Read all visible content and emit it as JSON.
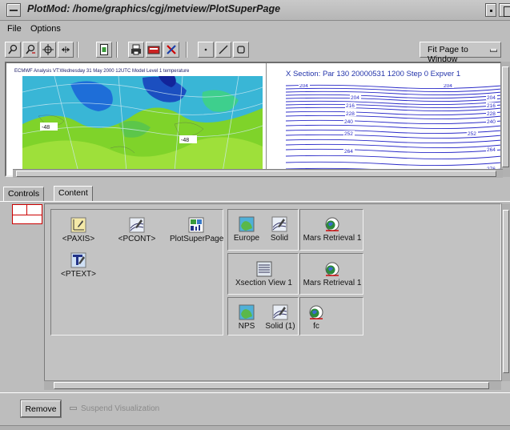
{
  "window": {
    "title": "PlotMod: /home/graphics/cgj/metview/PlotSuperPage"
  },
  "menu": {
    "items": [
      {
        "label": "File"
      },
      {
        "label": "Options"
      }
    ]
  },
  "toolbar": {
    "zoom_mode": "Fit Page to Window"
  },
  "plots": {
    "left_title": "ECMWF Analysis VT:Wednesday 31 May 2000 12UTC Model Level 1 temperature",
    "left_labels": [
      "-48",
      "-48",
      "-48",
      "-48"
    ],
    "right_title": "X Section: Par 130 20000531 1200 Step 0 Expver 1",
    "right_contours": [
      "204",
      "204",
      "204",
      "204",
      "216",
      "216",
      "228",
      "228",
      "240",
      "240",
      "252",
      "252",
      "264",
      "264",
      "276"
    ]
  },
  "tabs": [
    {
      "label": "Controls"
    },
    {
      "label": "Content"
    }
  ],
  "content": {
    "group1": [
      {
        "label": "<PAXIS>",
        "icon": "axis-icon"
      },
      {
        "label": "<PCONT>",
        "icon": "contour-icon"
      },
      {
        "label": "PlotSuperPage",
        "icon": "superpage-icon"
      },
      {
        "label": "<PTEXT>",
        "icon": "text-icon"
      }
    ],
    "group2": [
      {
        "label": "Europe",
        "icon": "map-icon"
      },
      {
        "label": "Solid",
        "icon": "contour-icon"
      }
    ],
    "group3": [
      {
        "label": "Mars Retrieval 1",
        "icon": "mars-icon"
      }
    ],
    "group4": [
      {
        "label": "Xsection View 1",
        "icon": "xsection-icon"
      }
    ],
    "group5": [
      {
        "label": "Mars Retrieval 1",
        "icon": "mars-icon"
      }
    ],
    "group6": [
      {
        "label": "NPS",
        "icon": "map-icon"
      },
      {
        "label": "Solid (1)",
        "icon": "contour-icon"
      }
    ],
    "group7": [
      {
        "label": "fc",
        "icon": "mars-icon"
      }
    ]
  },
  "bottom": {
    "remove_label": "Remove",
    "suspend_label": "Suspend Visualization"
  }
}
